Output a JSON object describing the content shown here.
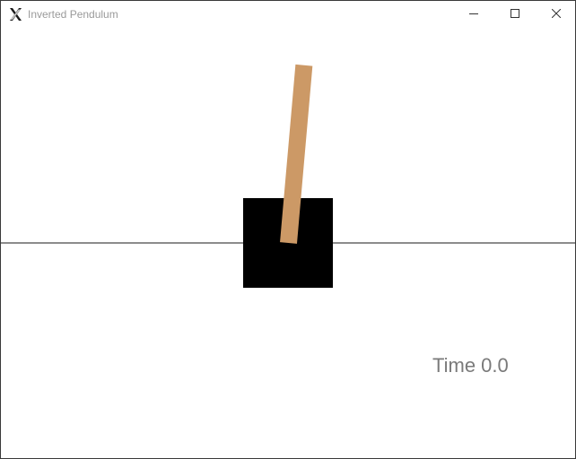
{
  "window": {
    "title": "Inverted Pendulum",
    "icons": {
      "app": "x-app-icon",
      "minimize": "minimize-icon",
      "maximize": "maximize-icon",
      "close": "close-icon"
    }
  },
  "simulation": {
    "time_label": "Time 0.0",
    "pole_angle_deg": 5,
    "colors": {
      "cart": "#000000",
      "pole": "#cc9966",
      "track": "#8c8c8c",
      "time_text": "#7a7a7a"
    }
  }
}
